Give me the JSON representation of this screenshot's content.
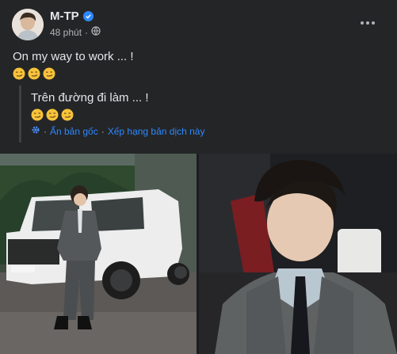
{
  "post": {
    "author": "M-TP",
    "time": "48 phút",
    "privacy_icon": "globe-icon",
    "verified_icon": "verified-badge-icon",
    "text": "On my way to work ... !",
    "emojis": [
      "smirk-emoji",
      "smirk-emoji",
      "smirk-emoji"
    ]
  },
  "translation": {
    "text": "Trên đường đi làm ... !",
    "emojis": [
      "smirk-emoji",
      "smirk-emoji",
      "smirk-emoji"
    ],
    "settings_icon": "gear-icon",
    "hide_original": "Ẩn bản gốc",
    "separator": "·",
    "rate_translation": "Xếp hạng bản dịch này"
  },
  "colors": {
    "background": "#242526",
    "text_primary": "#e4e6eb",
    "text_secondary": "#b0b3b8",
    "link": "#2d88ff",
    "verified": "#2d88ff"
  }
}
